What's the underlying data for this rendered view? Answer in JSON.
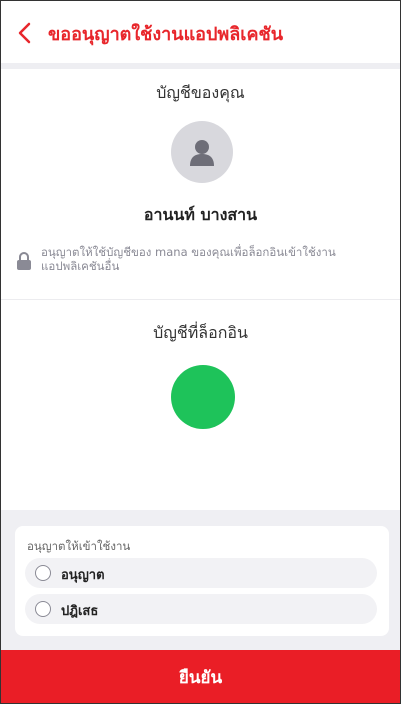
{
  "header": {
    "title": "ขออนุญาตใช้งานแอปพลิเคชัน"
  },
  "account": {
    "section_title": "บัญชีของคุณ",
    "name": "อานนท์  บางสาน",
    "permission_text": "อนุญาตให้ใช้บัญชีของ mana ของคุณเพื่อล็อกอินเข้าใช้งานแอปพลิเคชันอื่น"
  },
  "login": {
    "section_title": "บัญชีที่ล็อกอิน"
  },
  "consent": {
    "title": "อนุญาตให้เข้าใช้งาน",
    "options": [
      {
        "label": "อนุญาต"
      },
      {
        "label": "ปฎิเสธ"
      }
    ]
  },
  "confirm_label": "ยืนยัน",
  "colors": {
    "accent": "#e8262b",
    "login_app": "#1ec35a"
  },
  "icons": {
    "back": "chevron-left-icon",
    "avatar": "user-icon",
    "lock": "lock-icon"
  }
}
